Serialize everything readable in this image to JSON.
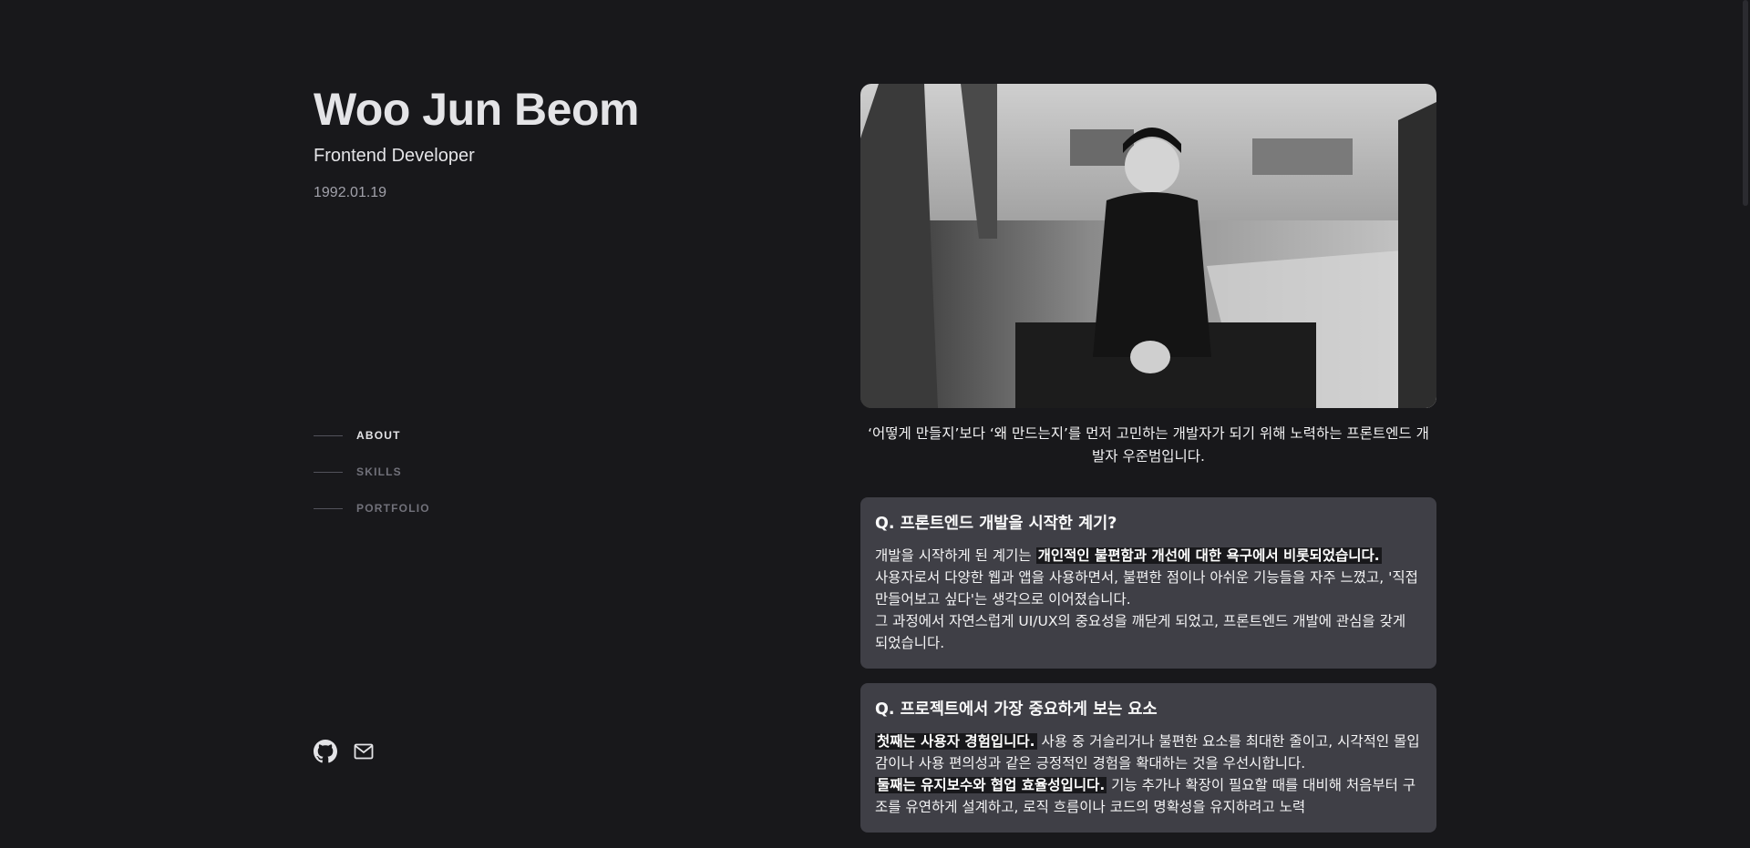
{
  "profile": {
    "name": "Woo Jun Beom",
    "role": "Frontend Developer",
    "birthdate": "1992.01.19"
  },
  "nav": {
    "items": [
      {
        "label": "ABOUT",
        "active": true
      },
      {
        "label": "SKILLS",
        "active": false
      },
      {
        "label": "PORTFOLIO",
        "active": false
      }
    ]
  },
  "socials": {
    "github_icon": "github-icon",
    "mail_icon": "mail-icon"
  },
  "about": {
    "intro": "‘어떻게 만들지’보다 ‘왜 만드는지’를 먼저 고민하는 개발자가 되기 위해 노력하는 프론트엔드 개발자 우준범입니다.",
    "cards": [
      {
        "title": "Q. 프론트엔드 개발을 시작한 계기?",
        "p1_pre": " 개발을 시작하게 된 계기는 ",
        "p1_hl": "개인적인 불편함과 개선에 대한 욕구에서 비롯되었습니다.",
        "p2": " 사용자로서 다양한 웹과 앱을 사용하면서, 불편한 점이나 아쉬운 기능들을 자주 느꼈고, '직접 만들어보고 싶다'는 생각으로 이어졌습니다.",
        "p3": " 그 과정에서 자연스럽게 UI/UX의 중요성을 깨닫게 되었고, 프론트엔드 개발에 관심을 갖게 되었습니다."
      },
      {
        "title": "Q. 프로젝트에서 가장 중요하게 보는 요소",
        "p1_hl": "첫째는 사용자 경험입니다.",
        "p1_post": " 사용 중 거슬리거나 불편한 요소를 최대한 줄이고, 시각적인 몰입감이나 사용 편의성과 같은 긍정적인 경험을 확대하는 것을 우선시합니다.",
        "p2_hl": "둘째는 유지보수와 협업 효율성입니다.",
        "p2_post": " 기능 추가나 확장이 필요할 때를 대비해 처음부터 구조를 유연하게 설계하고, 로직 흐름이나 코드의 명확성을 유지하려고 노력"
      }
    ]
  },
  "colors": {
    "background": "#18181b",
    "card": "#3f3f46",
    "text": "#e4e4e7",
    "muted": "#71717a"
  }
}
